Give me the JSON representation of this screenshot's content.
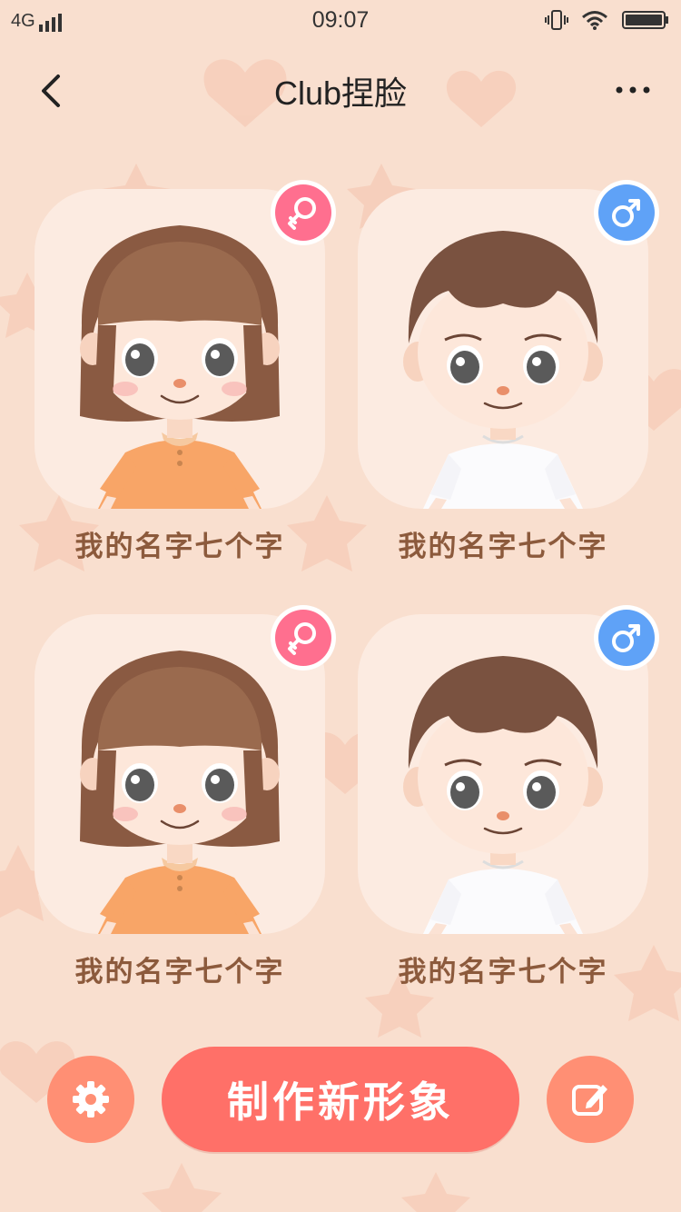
{
  "status_bar": {
    "network": "4G",
    "time": "09:07",
    "icons": [
      "signal-icon",
      "vibrate-icon",
      "wifi-icon",
      "battery-icon"
    ]
  },
  "nav": {
    "back_icon": "chevron-left-icon",
    "title": "Club捏脸",
    "more_icon": "more-horizontal-icon"
  },
  "characters": [
    {
      "name": "我的名字七个字",
      "gender": "female",
      "gender_icon": "female-icon",
      "badge_color": "#ff6f8f"
    },
    {
      "name": "我的名字七个字",
      "gender": "male",
      "gender_icon": "male-icon",
      "badge_color": "#5fa2f7"
    },
    {
      "name": "我的名字七个字",
      "gender": "female",
      "gender_icon": "female-icon",
      "badge_color": "#ff6f8f"
    },
    {
      "name": "我的名字七个字",
      "gender": "male",
      "gender_icon": "male-icon",
      "badge_color": "#5fa2f7"
    }
  ],
  "actions": {
    "settings_icon": "gear-icon",
    "create_label": "制作新形象",
    "edit_icon": "edit-icon"
  },
  "colors": {
    "background": "#f9dfcf",
    "accent": "#ff7068",
    "accent_light": "#ff8f74",
    "name_text": "#8c5a3c"
  }
}
